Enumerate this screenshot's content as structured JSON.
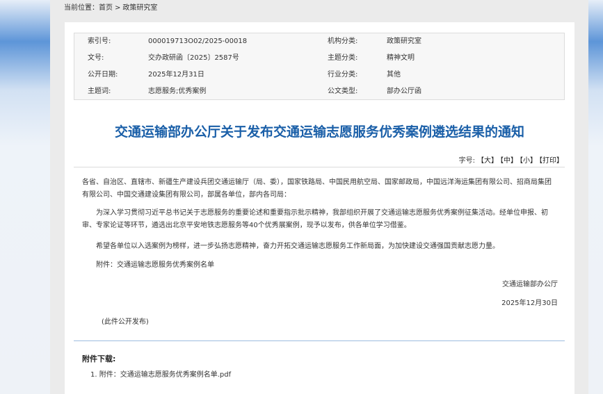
{
  "breadcrumb": {
    "label": "当前位置：",
    "home": "首页",
    "separator": ">",
    "current": "政策研究室"
  },
  "meta": {
    "rows": [
      {
        "k1": "索引号:",
        "v1": "000019713O02/2025-00018",
        "k2": "机构分类:",
        "v2": "政策研究室"
      },
      {
        "k1": "文号:",
        "v1": "交办政研函〔2025〕2587号",
        "k2": "主题分类:",
        "v2": "精神文明"
      },
      {
        "k1": "公开日期:",
        "v1": "2025年12月31日",
        "k2": "行业分类:",
        "v2": "其他"
      },
      {
        "k1": "主题词:",
        "v1": "志愿服务;优秀案例",
        "k2": "公文类型:",
        "v2": "部办公厅函"
      }
    ]
  },
  "title": "交通运输部办公厅关于发布交通运输志愿服务优秀案例遴选结果的通知",
  "font_size": {
    "label": "字号:",
    "large": "【大】",
    "medium": "【中】",
    "small": "【小】",
    "print": "【打印】"
  },
  "body": {
    "p1": "各省、自治区、直辖市、新疆生产建设兵团交通运输厅（局、委），国家铁路局、中国民用航空局、国家邮政局，中国远洋海运集团有限公司、招商局集团有限公司、中国交通建设集团有限公司，部属各单位，部内各司局：",
    "p2": "为深入学习贯彻习近平总书记关于志愿服务的重要论述和重要指示批示精神，我部组织开展了交通运输志愿服务优秀案例征集活动。经单位申报、初审、专家论证等环节，遴选出北京平安地铁志愿服务等40个优秀展案例，现予以发布，供各单位学习借鉴。",
    "p3": "希望各单位以入选案例为榜样，进一步弘扬志愿精神，奋力开拓交通运输志愿服务工作新局面，为加快建设交通强国贡献志愿力量。",
    "p4": "附件：交通运输志愿服务优秀案例名单",
    "sign_org": "交通运输部办公厅",
    "sign_date": "2025年12月30日",
    "note": "(此件公开发布)"
  },
  "downloads": {
    "title": "附件下载:",
    "items": [
      "1. 附件：交通运输志愿服务优秀案例名单.pdf"
    ]
  }
}
